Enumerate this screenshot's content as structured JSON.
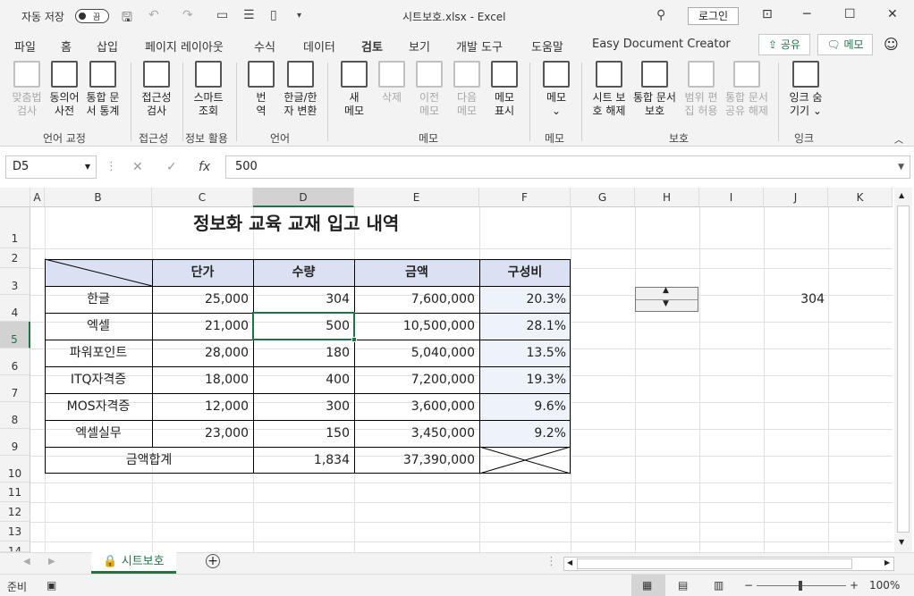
{
  "app": {
    "autosave_label": "자동 저장",
    "autosave_state": "끔",
    "window_title": "시트보호.xlsx  -  Excel",
    "login_label": "로그인"
  },
  "menu": {
    "items": [
      "파일",
      "홈",
      "삽입",
      "페이지 레이아웃",
      "수식",
      "데이터",
      "검토",
      "보기",
      "개발 도구",
      "도움말",
      "Easy Document Creator"
    ],
    "active": "검토",
    "share_label": "공유",
    "memo_label": "메모"
  },
  "ribbon": {
    "buttons": [
      {
        "l1": "맞춤법",
        "l2": "검사",
        "enabled": false
      },
      {
        "l1": "동의어",
        "l2": "사전",
        "enabled": true
      },
      {
        "l1": "통합 문",
        "l2": "서 통계",
        "enabled": true
      },
      {
        "l1": "접근성",
        "l2": "검사",
        "enabled": true
      },
      {
        "l1": "스마트",
        "l2": "조회",
        "enabled": true
      },
      {
        "l1": "번",
        "l2": "역",
        "enabled": true
      },
      {
        "l1": "한글/한",
        "l2": "자 변환",
        "enabled": true
      },
      {
        "l1": "새",
        "l2": "메모",
        "enabled": true
      },
      {
        "l1": "삭제",
        "l2": "",
        "enabled": false
      },
      {
        "l1": "이전",
        "l2": "메모",
        "enabled": false
      },
      {
        "l1": "다음",
        "l2": "메모",
        "enabled": false
      },
      {
        "l1": "메모",
        "l2": "표시",
        "enabled": true
      },
      {
        "l1": "메모",
        "l2": "⌄",
        "enabled": true
      },
      {
        "l1": "시트 보",
        "l2": "호 해제",
        "enabled": true
      },
      {
        "l1": "통합 문서",
        "l2": "보호",
        "enabled": true
      },
      {
        "l1": "범위 편",
        "l2": "집 허용",
        "enabled": false
      },
      {
        "l1": "통합 문서",
        "l2": "공유 해제",
        "enabled": false
      },
      {
        "l1": "잉크 숨",
        "l2": "기기 ⌄",
        "enabled": true
      }
    ],
    "groups": [
      "언어 교정",
      "접근성",
      "정보 활용",
      "언어",
      "메모",
      "메모",
      "보호",
      "잉크"
    ]
  },
  "formula_bar": {
    "name_box": "D5",
    "value": "500",
    "fx": "fx"
  },
  "columns": [
    "A",
    "B",
    "C",
    "D",
    "E",
    "F",
    "G",
    "H",
    "I",
    "J",
    "K"
  ],
  "rows": [
    "1",
    "2",
    "3",
    "4",
    "5",
    "6",
    "7",
    "8",
    "9",
    "10",
    "11",
    "12",
    "13",
    "14"
  ],
  "sheet": {
    "title": "정보화 교육 교재 입고 내역",
    "headers": [
      "단가",
      "수량",
      "금액",
      "구성비"
    ],
    "rows": [
      {
        "name": "한글",
        "price": "25,000",
        "qty": "304",
        "amount": "7,600,000",
        "ratio": "20.3%"
      },
      {
        "name": "엑셀",
        "price": "21,000",
        "qty": "500",
        "amount": "10,500,000",
        "ratio": "28.1%"
      },
      {
        "name": "파워포인트",
        "price": "28,000",
        "qty": "180",
        "amount": "5,040,000",
        "ratio": "13.5%"
      },
      {
        "name": "ITQ자격증",
        "price": "18,000",
        "qty": "400",
        "amount": "7,200,000",
        "ratio": "19.3%"
      },
      {
        "name": "MOS자격증",
        "price": "12,000",
        "qty": "300",
        "amount": "3,600,000",
        "ratio": "9.6%"
      },
      {
        "name": "엑셀실무",
        "price": "23,000",
        "qty": "150",
        "amount": "3,450,000",
        "ratio": "9.2%"
      }
    ],
    "total_label": "금액합계",
    "total_qty": "1,834",
    "total_amount": "37,390,000",
    "j4_value": "304"
  },
  "tabs": {
    "active": "시트보호",
    "add": "+"
  },
  "status": {
    "ready": "준비",
    "zoom": "100%"
  }
}
